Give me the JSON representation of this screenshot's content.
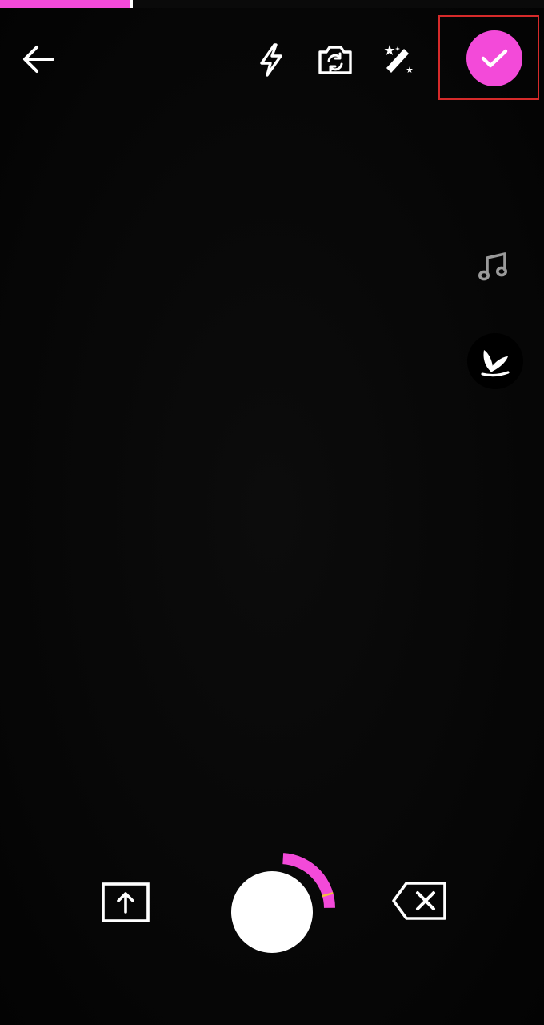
{
  "app": {
    "screen": "camera-recorder"
  },
  "recording": {
    "progress_fraction": 0.24,
    "record_segment_color": "#f34ad9",
    "segment_marker_color": "#f2c23a"
  },
  "colors": {
    "accent": "#f34ad9",
    "background": "#050505",
    "icon": "#ffffff",
    "highlight_frame": "#d62a2a"
  },
  "icons": {
    "back": "arrow-left-icon",
    "flash": "lightning-bolt-icon",
    "flip": "camera-flip-icon",
    "effects": "magic-wand-icon",
    "confirm": "checkmark-icon",
    "music": "music-note-icon",
    "filter": "bunny-ears-icon",
    "upload": "upload-arrow-icon",
    "delete": "backspace-x-icon"
  }
}
